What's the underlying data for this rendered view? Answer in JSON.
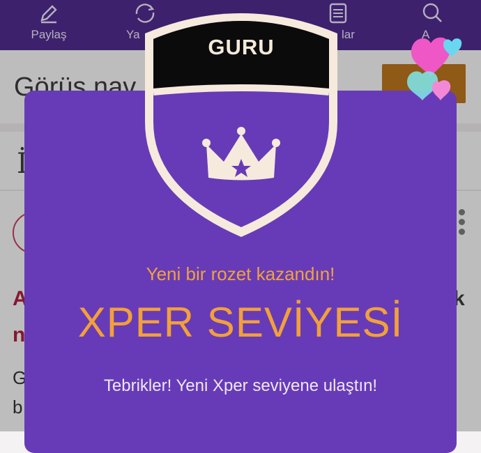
{
  "top_nav": {
    "items": [
      {
        "label": "Paylaş",
        "icon": "pencil-icon"
      },
      {
        "label": "Ya",
        "icon": "refresh-icon"
      },
      {
        "label": "lar",
        "icon": "list-icon"
      },
      {
        "label": "A",
        "icon": "search-icon"
      }
    ]
  },
  "background": {
    "title": "Görüş nav",
    "i_glyph": "İ",
    "a_glyph": "A",
    "n_glyph": "n",
    "k_glyph": "k",
    "g_glyph": "G",
    "b_glyph": "b"
  },
  "badge": {
    "label": "GURU",
    "icon": "crown-icon"
  },
  "modal": {
    "subtitle": "Yeni bir rozet kazandın!",
    "level_title": "XPER SEVİYESİ",
    "message": "Tebrikler! Yeni Xper seviyene ulaştın!"
  },
  "colors": {
    "nav_bg": "#4f2b8c",
    "modal_bg": "#673bb7",
    "accent_orange": "#f2a03a",
    "badge_cream": "#f6eadd",
    "badge_black": "#0b0b0b"
  }
}
